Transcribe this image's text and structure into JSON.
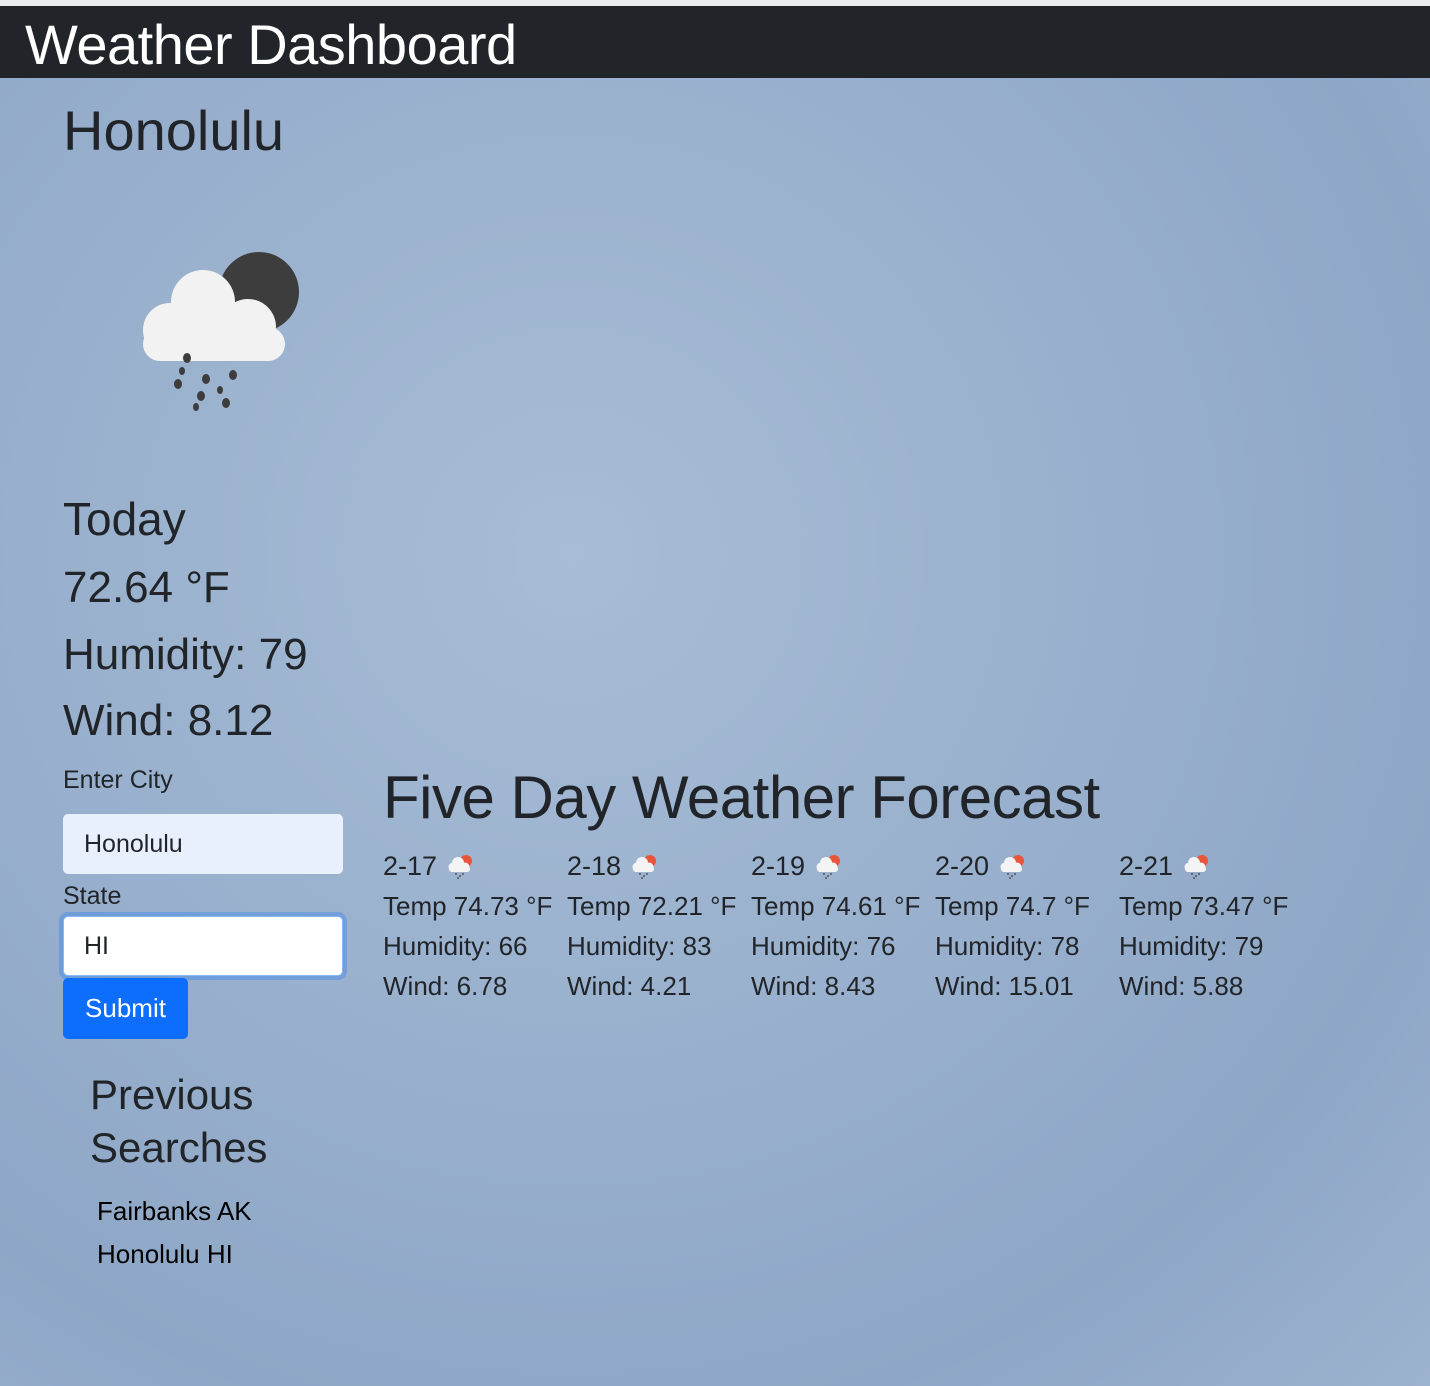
{
  "header": {
    "title": "Weather Dashboard"
  },
  "current": {
    "city": "Honolulu",
    "icon": "cloud-rain-night-icon",
    "today_label": "Today",
    "temp": "72.64 °F",
    "humidity": "Humidity: 79",
    "wind": "Wind: 8.12"
  },
  "form": {
    "city_label": "Enter City",
    "city_value": "Honolulu",
    "state_label": "State",
    "state_value": "HI",
    "submit_label": "Submit"
  },
  "previous": {
    "title": "Previous Searches",
    "items": [
      "Fairbanks AK",
      "Honolulu HI"
    ]
  },
  "forecast": {
    "title": "Five Day Weather Forecast",
    "days": [
      {
        "date": "2-17",
        "icon": "cloud-rain-day-icon",
        "temp": "Temp 74.73 °F",
        "humidity": "Humidity: 66",
        "wind": "Wind: 6.78"
      },
      {
        "date": "2-18",
        "icon": "cloud-rain-day-icon",
        "temp": "Temp 72.21 °F",
        "humidity": "Humidity: 83",
        "wind": "Wind: 4.21"
      },
      {
        "date": "2-19",
        "icon": "cloud-rain-day-icon",
        "temp": "Temp 74.61 °F",
        "humidity": "Humidity: 76",
        "wind": "Wind: 8.43"
      },
      {
        "date": "2-20",
        "icon": "cloud-rain-day-icon",
        "temp": "Temp 74.7 °F",
        "humidity": "Humidity: 78",
        "wind": "Wind: 15.01"
      },
      {
        "date": "2-21",
        "icon": "cloud-rain-day-icon",
        "temp": "Temp 73.47 °F",
        "humidity": "Humidity: 79",
        "wind": "Wind: 5.88"
      }
    ]
  },
  "colors": {
    "navbar": "#212529",
    "primary": "#0d6efd",
    "sun_accent": "#e8553a",
    "moon": "#3d3d3d"
  }
}
